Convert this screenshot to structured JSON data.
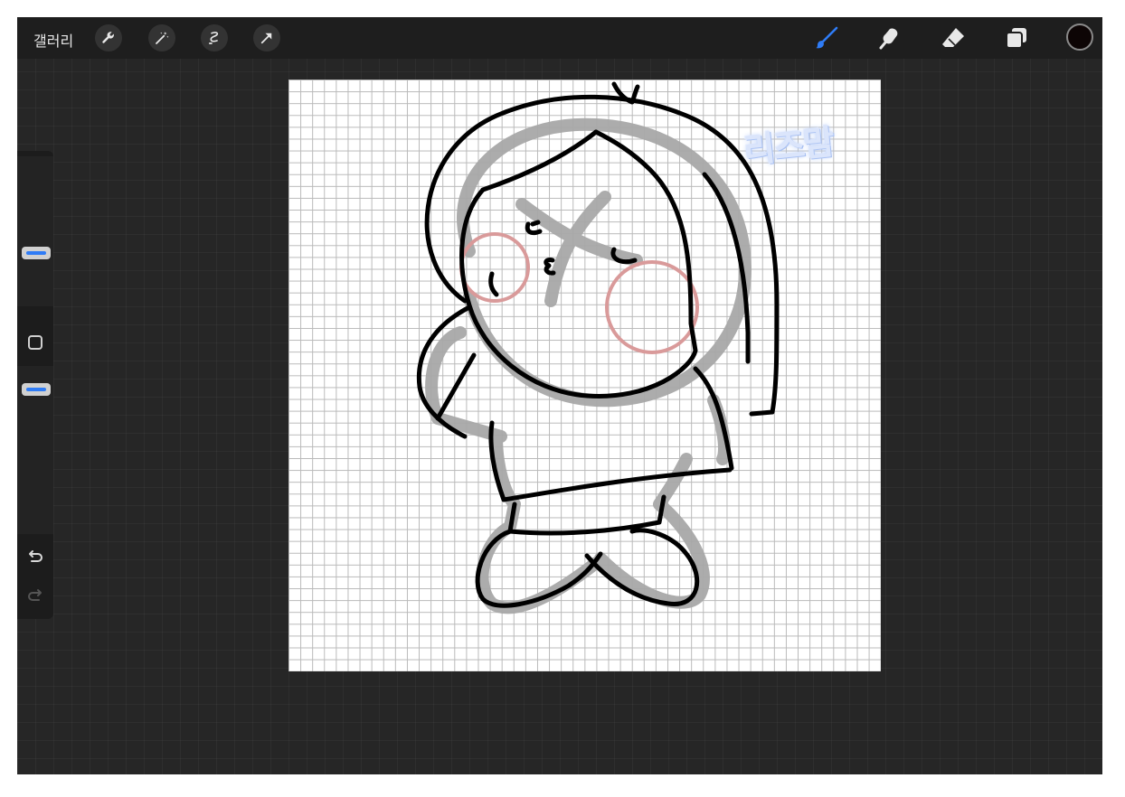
{
  "topbar": {
    "gallery_label": "갤러리",
    "left_tools": [
      "wrench-icon",
      "magic-wand-icon",
      "selection-icon",
      "transform-arrow-icon"
    ],
    "right_tools": [
      "brush-icon",
      "smudge-icon",
      "eraser-icon",
      "layers-icon"
    ],
    "active_tool": "brush",
    "current_color": "#0d0505",
    "accent_color": "#2f7cf6"
  },
  "sidebar": {
    "sliders": [
      "brush-size-slider",
      "opacity-slider"
    ],
    "buttons": [
      "modify-button",
      "undo-button",
      "redo-button"
    ]
  },
  "canvas": {
    "watermark": "리즈맘",
    "background": "#ffffff",
    "grid": true
  }
}
